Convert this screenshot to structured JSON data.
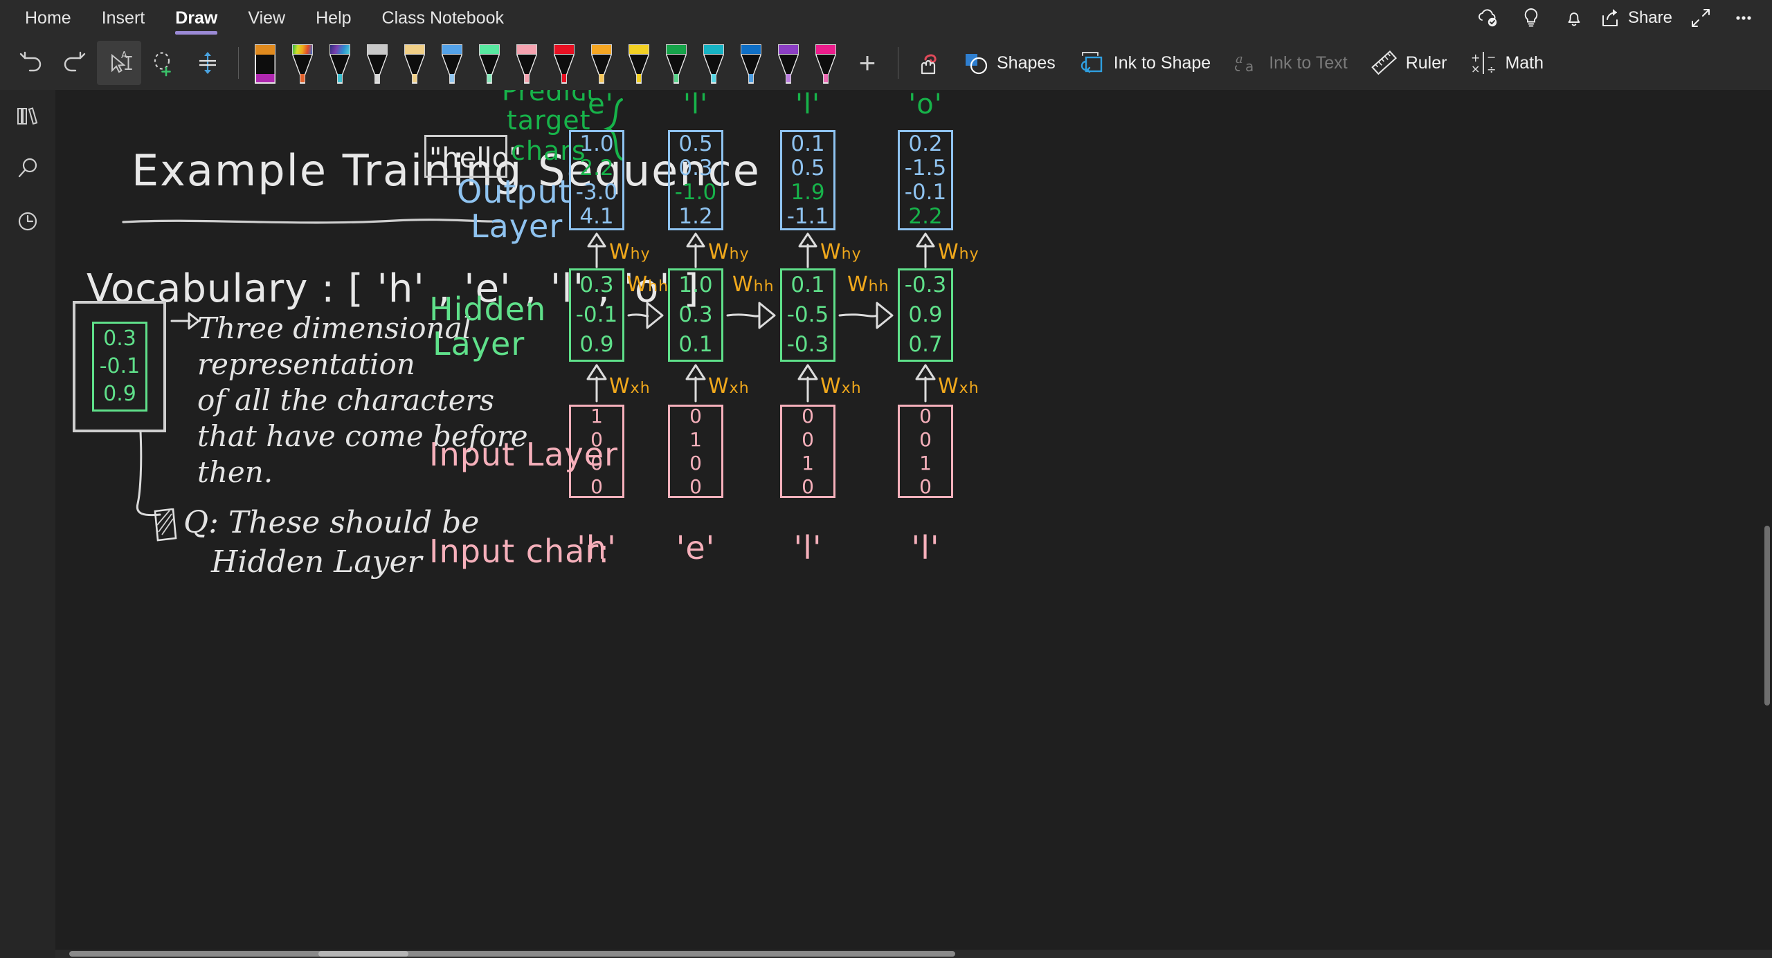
{
  "app": {
    "background_color": "#1f1f1f",
    "ribbon_color": "#2b2b2b"
  },
  "ribbon": {
    "tabs": [
      {
        "label": "Home",
        "active": false
      },
      {
        "label": "Insert",
        "active": false
      },
      {
        "label": "Draw",
        "active": true
      },
      {
        "label": "View",
        "active": false
      },
      {
        "label": "Help",
        "active": false
      },
      {
        "label": "Class Notebook",
        "active": false
      }
    ],
    "right_actions": [
      {
        "label": "",
        "icon": "cloud-sync-icon"
      },
      {
        "label": "",
        "icon": "lightbulb-icon"
      },
      {
        "label": "",
        "icon": "bell-icon"
      },
      {
        "label": "Share",
        "icon": "share-icon"
      },
      {
        "label": "",
        "icon": "expand-icon"
      },
      {
        "label": "",
        "icon": "more-options-icon"
      }
    ],
    "share_label": "Share"
  },
  "toolbar": {
    "undo_label": "Undo",
    "redo_label": "Redo",
    "select_label": "Select",
    "lasso_label": "Lasso Select",
    "space_label": "Insert Space",
    "add_pen_label": "+",
    "items": [
      {
        "label": "Shapes",
        "icon": "shapes-icon",
        "disabled": false
      },
      {
        "label": "Ink to Shape",
        "icon": "ink-to-shape-icon",
        "disabled": false
      },
      {
        "label": "Ink to Text",
        "icon": "ink-to-text-icon",
        "disabled": true
      },
      {
        "label": "Ruler",
        "icon": "ruler-icon",
        "disabled": false
      },
      {
        "label": "Math",
        "icon": "math-icon",
        "disabled": false
      }
    ],
    "pens": [
      {
        "name": "highlighter-purple",
        "type": "highlighter",
        "cap": "#e08a1e",
        "ink": "#b028b0"
      },
      {
        "name": "pen-rainbow",
        "type": "pen",
        "cap": "rainbow",
        "ink": "#e2622c"
      },
      {
        "name": "pen-galaxy",
        "type": "pen",
        "cap": "galaxy",
        "ink": "#3fbfcf"
      },
      {
        "name": "pen-silver",
        "type": "pen",
        "cap": "#c8c8c8",
        "ink": "#d8d8d8"
      },
      {
        "name": "pen-gold",
        "type": "pen",
        "cap": "#f0cf87",
        "ink": "#f0cf87"
      },
      {
        "name": "pen-lightblue",
        "type": "pen",
        "cap": "#54a2e8",
        "ink": "#93c6ef"
      },
      {
        "name": "pen-mint",
        "type": "pen",
        "cap": "#58e8a0",
        "ink": "#8ae8bc"
      },
      {
        "name": "pen-pink",
        "type": "pen",
        "cap": "#f5a3b0",
        "ink": "#f5a3b0"
      },
      {
        "name": "pen-red",
        "type": "pen",
        "cap": "#e81123",
        "ink": "#e81123"
      },
      {
        "name": "pen-orange",
        "type": "pen",
        "cap": "#f5a623",
        "ink": "#f5c65a"
      },
      {
        "name": "pen-yellow",
        "type": "pen",
        "cap": "#f2d024",
        "ink": "#f2d024"
      },
      {
        "name": "pen-green",
        "type": "pen",
        "cap": "#16a34a",
        "ink": "#5ad38b"
      },
      {
        "name": "pen-teal",
        "type": "pen",
        "cap": "#17b3c4",
        "ink": "#5ad6e4"
      },
      {
        "name": "pen-blue",
        "type": "pen",
        "cap": "#0f6fc6",
        "ink": "#4e9de0"
      },
      {
        "name": "pen-violet",
        "type": "pen",
        "cap": "#8c3fc4",
        "ink": "#bd7fe0"
      },
      {
        "name": "pen-magenta",
        "type": "pen",
        "cap": "#ec1d8c",
        "ink": "#ec6bb4"
      }
    ]
  },
  "leftrail": {
    "items": [
      {
        "name": "notebooks-icon",
        "label": "Notebooks"
      },
      {
        "name": "search-icon",
        "label": "Search"
      },
      {
        "name": "recent-icon",
        "label": "Recent Notes"
      }
    ]
  },
  "canvas": {
    "colors": {
      "white_ink": "#e8e8e8",
      "green_ink": "#5fe08a",
      "bright_green_ink": "#17b34a",
      "blue_ink": "#8fc3f0",
      "pink_ink": "#f6b0bb",
      "yellow_ink": "#f0a81c"
    },
    "title": "Example  Training  Sequence",
    "title_boxed_word": "\"hello\"",
    "vocabulary_line": "Vocabulary : [ 'h' , 'e' , 'l' , 'o' ]",
    "left_note": {
      "vector": [
        "0.3",
        "-0.1",
        "0.9"
      ],
      "arrow": "→",
      "lines": [
        "Three dimensional",
        "representation",
        "of all the characters",
        "that have come before",
        "then."
      ],
      "question_marker": "note-icon",
      "question_lines": [
        "Q: These should be",
        "Hidden Layer"
      ]
    },
    "labels": {
      "predict": "Predict",
      "target": "target",
      "chars": "chars",
      "output_layer_line1": "Output",
      "output_layer_line2": "Layer",
      "hidden_layer_line1": "Hidden",
      "hidden_layer_line2": "Layer",
      "input_layer": "Input Layer",
      "input_char": "Input char:",
      "w_hy": "W",
      "w_hy_sub": "hy",
      "w_hh": "W",
      "w_hh_sub": "hh",
      "w_xh": "W",
      "w_xh_sub": "xh"
    },
    "timesteps": [
      {
        "target_char": "'e'",
        "output": [
          {
            "v": "1.0",
            "hl": false
          },
          {
            "v": "2.2",
            "hl": true
          },
          {
            "v": "-3.0",
            "hl": false
          },
          {
            "v": "4.1",
            "hl": false
          }
        ],
        "hidden": [
          "0.3",
          "-0.1",
          "0.9"
        ],
        "input": [
          "1",
          "0",
          "0",
          "0"
        ],
        "input_char": "'h'"
      },
      {
        "target_char": "'l'",
        "output": [
          {
            "v": "0.5",
            "hl": false
          },
          {
            "v": "0.3",
            "hl": false
          },
          {
            "v": "-1.0",
            "hl": true
          },
          {
            "v": "1.2",
            "hl": false
          }
        ],
        "hidden": [
          "1.0",
          "0.3",
          "0.1"
        ],
        "input": [
          "0",
          "1",
          "0",
          "0"
        ],
        "input_char": "'e'"
      },
      {
        "target_char": "'l'",
        "output": [
          {
            "v": "0.1",
            "hl": false
          },
          {
            "v": "0.5",
            "hl": false
          },
          {
            "v": "1.9",
            "hl": true
          },
          {
            "v": "-1.1",
            "hl": false
          }
        ],
        "hidden": [
          "0.1",
          "-0.5",
          "-0.3"
        ],
        "input": [
          "0",
          "0",
          "1",
          "0"
        ],
        "input_char": "'l'"
      },
      {
        "target_char": "'o'",
        "output": [
          {
            "v": "0.2",
            "hl": false
          },
          {
            "v": "-1.5",
            "hl": false
          },
          {
            "v": "-0.1",
            "hl": false
          },
          {
            "v": "2.2",
            "hl": true
          }
        ],
        "hidden": [
          "-0.3",
          "0.9",
          "0.7"
        ],
        "input": [
          "0",
          "0",
          "1",
          "0"
        ],
        "input_char": "'l'"
      }
    ]
  }
}
